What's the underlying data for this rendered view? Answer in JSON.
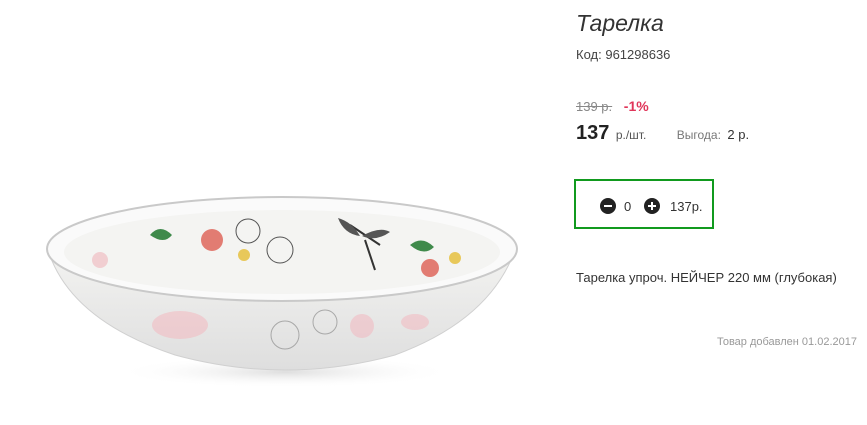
{
  "product": {
    "title": "Тарелка",
    "code_label": "Код:",
    "code_value": "961298636",
    "old_price": "139 р.",
    "discount": "-1%",
    "price": "137",
    "unit": "р./шт.",
    "benefit_label": "Выгода:",
    "benefit_value": "2 р.",
    "description": "Тарелка упроч. НЕЙЧЕР 220 мм (глубокая)",
    "added_date": "Товар добавлен 01.02.2017",
    "image_icon": "plate-photo"
  },
  "cart": {
    "quantity": "0",
    "total": "137р.",
    "minus_icon": "minus-circle-icon",
    "plus_icon": "plus-circle-icon",
    "border_color": "#119a1e"
  },
  "colors": {
    "discount": "#e0365a",
    "accent_green": "#119a1e"
  }
}
